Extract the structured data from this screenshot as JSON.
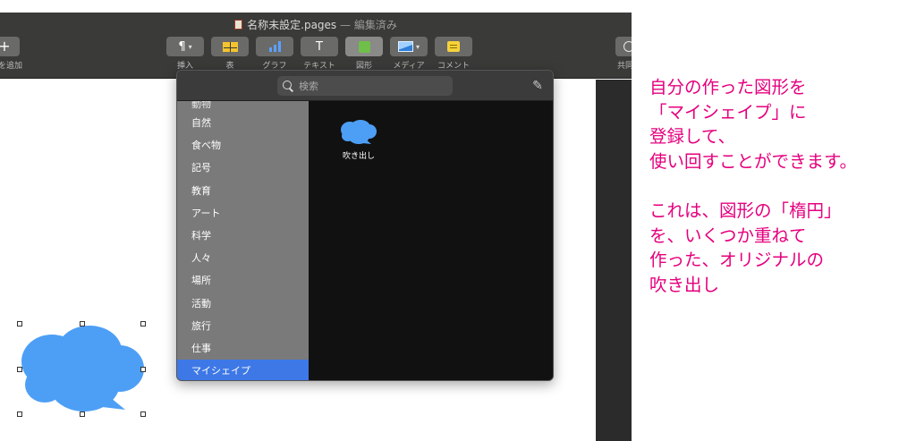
{
  "window": {
    "document_name": "名称未設定.pages",
    "separator": " — ",
    "status": "編集済み"
  },
  "toolbar": {
    "buttons": [
      {
        "id": "add-page",
        "icon": "plus-icon",
        "label": "を追加"
      },
      {
        "id": "insert",
        "icon": "paragraph-icon",
        "label": "挿入"
      },
      {
        "id": "table",
        "icon": "table-icon",
        "label": "表"
      },
      {
        "id": "chart",
        "icon": "chart-icon",
        "label": "グラフ"
      },
      {
        "id": "text",
        "icon": "text-icon",
        "label": "テキスト"
      },
      {
        "id": "shape",
        "icon": "shape-icon",
        "label": "図形"
      },
      {
        "id": "media",
        "icon": "media-icon",
        "label": "メディア"
      },
      {
        "id": "comment",
        "icon": "comment-icon",
        "label": "コメント"
      },
      {
        "id": "collaborate",
        "icon": "share-icon",
        "label": "共同"
      }
    ],
    "paragraph_glyph": "¶",
    "text_glyph": "T",
    "plus_glyph": "+"
  },
  "shapes_popover": {
    "search_placeholder": "検索",
    "categories": [
      {
        "label": "動物",
        "partial": true,
        "selected": false
      },
      {
        "label": "自然",
        "partial": false,
        "selected": false
      },
      {
        "label": "食べ物",
        "partial": false,
        "selected": false
      },
      {
        "label": "記号",
        "partial": false,
        "selected": false
      },
      {
        "label": "教育",
        "partial": false,
        "selected": false
      },
      {
        "label": "アート",
        "partial": false,
        "selected": false
      },
      {
        "label": "科学",
        "partial": false,
        "selected": false
      },
      {
        "label": "人々",
        "partial": false,
        "selected": false
      },
      {
        "label": "場所",
        "partial": false,
        "selected": false
      },
      {
        "label": "活動",
        "partial": false,
        "selected": false
      },
      {
        "label": "旅行",
        "partial": false,
        "selected": false
      },
      {
        "label": "仕事",
        "partial": false,
        "selected": false
      },
      {
        "label": "マイシェイプ",
        "partial": false,
        "selected": true
      }
    ],
    "shapes": [
      {
        "label": "吹き出し",
        "icon": "speech-cloud-icon"
      }
    ]
  },
  "colors": {
    "shape_blue": "#4d9ff5",
    "selection_blue": "#3d78e6",
    "annotation_pink": "#e5007e"
  },
  "annotation": {
    "lines": [
      "自分の作った図形を",
      "「マイシェイプ」に",
      "登録して、",
      "使い回すことができます。"
    ],
    "lines2": [
      "これは、図形の「楕円」",
      "を、いくつか重ねて",
      "作った、オリジナルの",
      "吹き出し"
    ]
  }
}
